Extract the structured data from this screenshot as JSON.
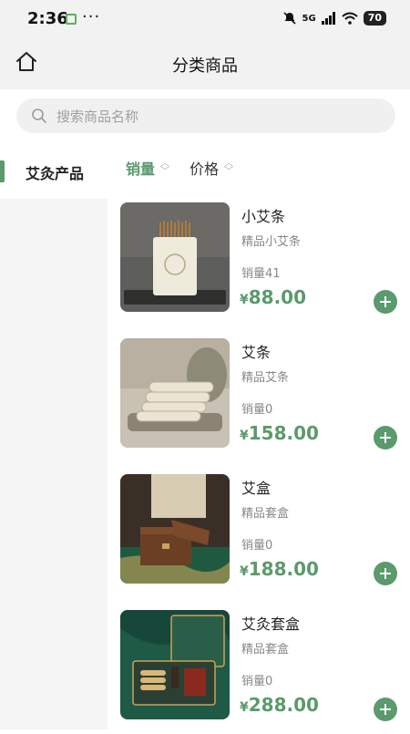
{
  "status_bar": {
    "time": "2:36",
    "more": "···",
    "network": "5G",
    "battery": "70"
  },
  "nav": {
    "title": "分类商品",
    "home_icon": "home-icon"
  },
  "search": {
    "placeholder": "搜索商品名称",
    "icon": "search-icon"
  },
  "sidebar": {
    "items": [
      {
        "label": "艾灸产品",
        "active": true
      }
    ]
  },
  "sort": {
    "options": [
      {
        "label": "销量",
        "active": true
      },
      {
        "label": "价格",
        "active": false
      }
    ]
  },
  "products": [
    {
      "name": "小艾条",
      "subtitle": "精品小艾条",
      "sales": "销量41",
      "currency": "¥",
      "price": "88.00"
    },
    {
      "name": "艾条",
      "subtitle": "精品艾条",
      "sales": "销量0",
      "currency": "¥",
      "price": "158.00"
    },
    {
      "name": "艾盒",
      "subtitle": "精品套盒",
      "sales": "销量0",
      "currency": "¥",
      "price": "188.00"
    },
    {
      "name": "艾灸套盒",
      "subtitle": "精品套盒",
      "sales": "销量0",
      "currency": "¥",
      "price": "288.00"
    }
  ],
  "colors": {
    "accent": "#5b9a6c",
    "background": "#f2f2f2"
  }
}
